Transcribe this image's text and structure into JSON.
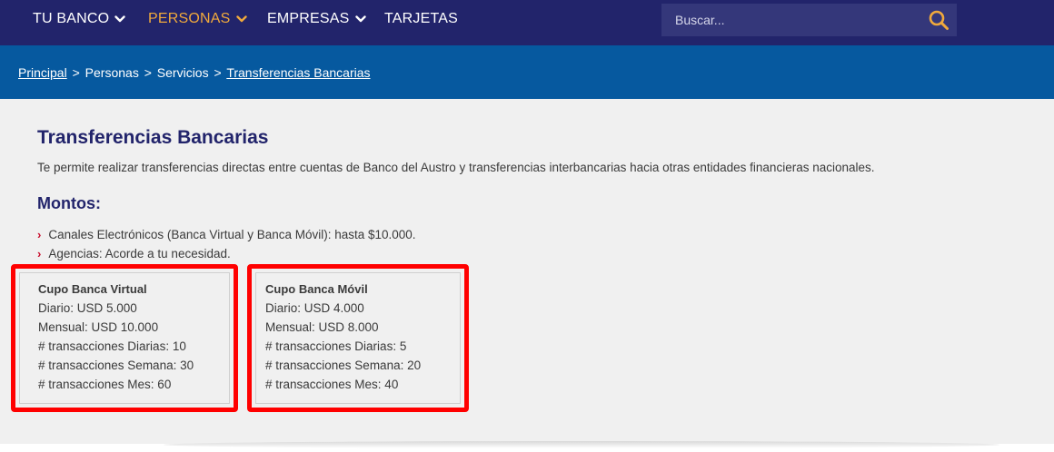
{
  "nav": {
    "items": [
      {
        "label": "TU BANCO",
        "has_dropdown": true,
        "active": false
      },
      {
        "label": "PERSONAS",
        "has_dropdown": true,
        "active": true
      },
      {
        "label": "EMPRESAS",
        "has_dropdown": true,
        "active": false
      },
      {
        "label": "TARJETAS",
        "has_dropdown": false,
        "active": false
      }
    ],
    "search_placeholder": "Buscar...",
    "search_icon": "search-icon"
  },
  "breadcrumb": {
    "items": [
      "Principal",
      "Personas",
      "Servicios",
      "Transferencias Bancarias"
    ],
    "separator": ">"
  },
  "main": {
    "title": "Transferencias Bancarias",
    "description": "Te permite realizar transferencias directas entre cuentas de Banco del Austro y transferencias interbancarias hacia otras entidades financieras nacionales.",
    "montos_title": "Montos:",
    "montos_items": [
      "Canales Electrónicos (Banca Virtual y Banca Móvil): hasta $10.000.",
      "Agencias: Acorde a tu necesidad."
    ]
  },
  "cupos": [
    {
      "title": "Cupo Banca Virtual",
      "lines": [
        "Diario: USD 5.000",
        "Mensual: USD 10.000",
        "# transacciones Diarias: 10",
        "# transacciones Semana: 30",
        "# transacciones Mes: 60"
      ]
    },
    {
      "title": "Cupo Banca Móvil",
      "lines": [
        "Diario: USD 4.000",
        "Mensual: USD 8.000",
        "# transacciones Diarias: 5",
        "# transacciones Semana: 20",
        "# transacciones Mes: 40"
      ]
    }
  ],
  "colors": {
    "nav_bg": "#22246b",
    "nav_active": "#f0a93c",
    "breadcrumb_bg": "#06599f",
    "title": "#22246b",
    "highlight": "#ff0000",
    "bullet_chevron": "#c8102e"
  }
}
